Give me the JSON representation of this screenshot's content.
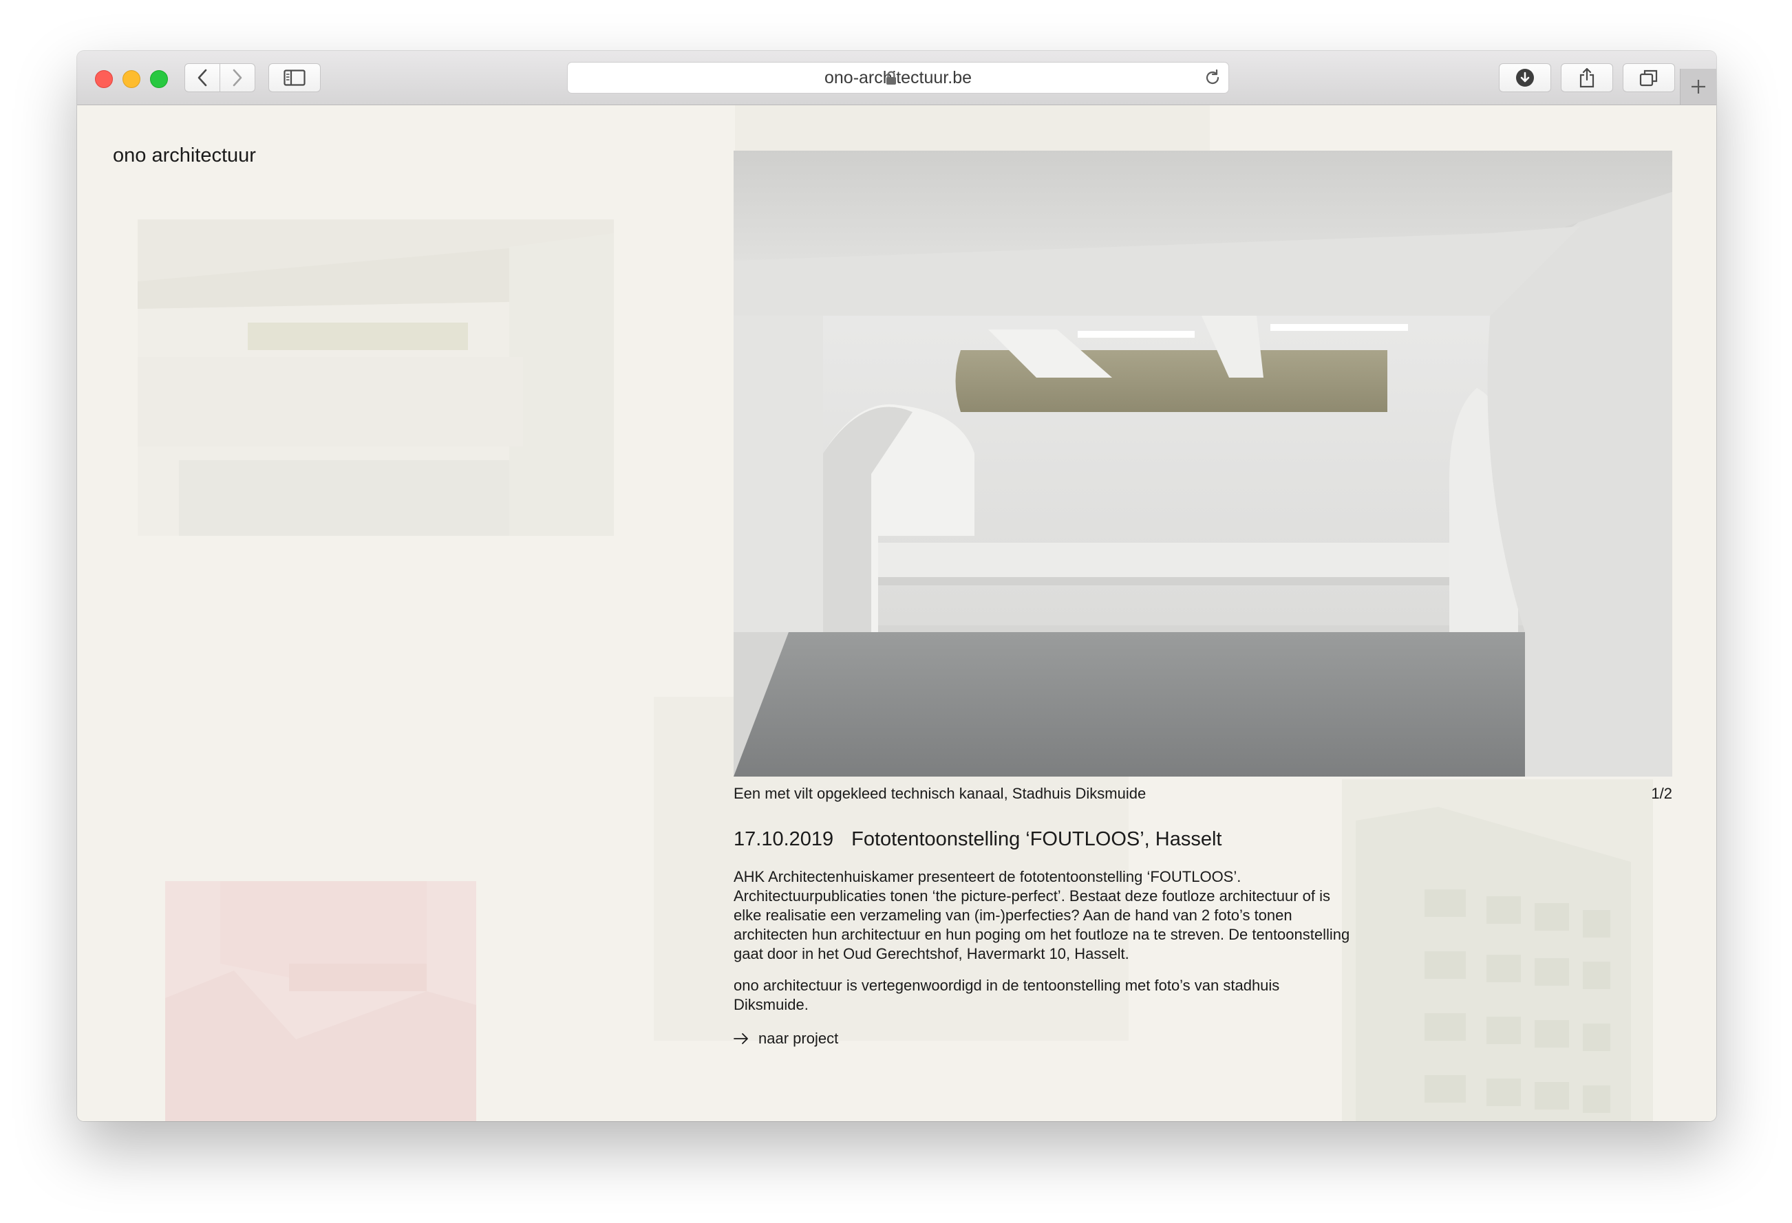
{
  "browser": {
    "url": "ono-architectuur.be",
    "icons": {
      "back": "chevron-left-icon",
      "forward": "chevron-right-icon",
      "sidebar": "sidebar-icon",
      "lock": "lock-icon",
      "reload": "reload-icon",
      "download": "download-icon",
      "share": "share-icon",
      "tabs": "tabs-overview-icon",
      "new_tab": "plus-icon"
    }
  },
  "site": {
    "logo": "ono architectuur"
  },
  "slideshow": {
    "caption": "Een met vilt opgekleed technisch kanaal, Stadhuis Diksmuide",
    "counter": "1/2"
  },
  "news": {
    "date": "17.10.2019",
    "title": "Fototentoonstelling ‘FOUTLOOS’, Hasselt",
    "paragraph1": "AHK Architectenhuiskamer presenteert de fototentoonstelling ‘FOUTLOOS’. Architectuurpublicaties tonen ‘the picture-perfect’. Bestaat deze foutloze architectuur of is elke realisatie een verzameling van (im-)perfecties? Aan de hand van 2 foto’s tonen architecten hun architectuur en hun poging om het foutloze na te streven. De tentoonstelling gaat door in het Oud Gerechtshof, Havermarkt 10, Hasselt.",
    "paragraph2": "ono architectuur is vertegenwoordigd in de tentoonstelling met foto’s van stadhuis Diksmuide.",
    "link_label": "naar project"
  },
  "colors": {
    "page_background": "#f4f2ec",
    "text": "#1a1a1a"
  }
}
